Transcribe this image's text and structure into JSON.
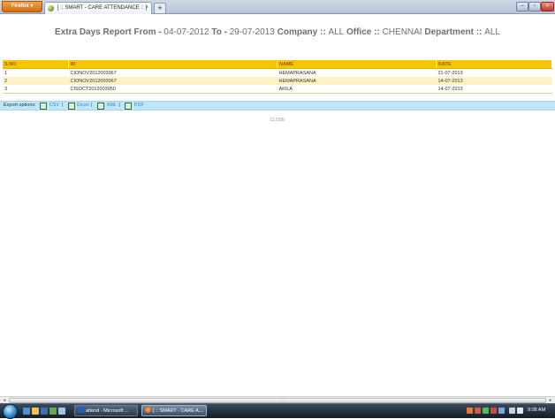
{
  "browser": {
    "menu_button": "Firefox ▾",
    "tab_title": "[ :: SMART - CARE ATTENDANCE :: ]",
    "tab_close": "×",
    "new_tab": "+",
    "window_controls": {
      "minimize": "–",
      "maximize": "▫",
      "close": "×"
    }
  },
  "report": {
    "title_prefix": "Extra Days Report From - ",
    "from_date": "04-07-2012",
    "to_label": " To - ",
    "to_date": "29-07-2013",
    "company_label": " Company :: ",
    "company_value": "ALL",
    "office_label": " Office :: ",
    "office_value": "CHENNAI",
    "department_label": " Department :: ",
    "department_value": "ALL"
  },
  "table": {
    "columns": [
      "S.NO",
      "ID",
      "NAME",
      "DATE"
    ],
    "rows": [
      [
        "1",
        "CIONOV2012003967",
        "HEMAPRASANA",
        "21-07-2013"
      ],
      [
        "2",
        "CIONOV2012003967",
        "HEMAPRASANA",
        "14-07-2013"
      ],
      [
        "3",
        "CISOCT2012003950",
        "AKILA",
        "14-07-2013"
      ]
    ]
  },
  "export": {
    "label": "Export options:",
    "csv": "CSV",
    "excel": "Excel",
    "xml": "XML",
    "pdf": "PDF",
    "separator": "|"
  },
  "close_label": "CLOSE",
  "scrollbar": {
    "left_arrow": "◂",
    "right_arrow": "▸",
    "grip": "⋮"
  },
  "taskbar": {
    "tasks": [
      {
        "label": "attend - Microsoft ..."
      },
      {
        "label": "[ :: SMART - CARE A..."
      }
    ],
    "clock": "9:08 AM"
  },
  "colors": {
    "table_header": "#f9c400",
    "row_alt": "#fff3c6",
    "export_bar": "#bfe6fb",
    "link": "#3d86c6"
  }
}
